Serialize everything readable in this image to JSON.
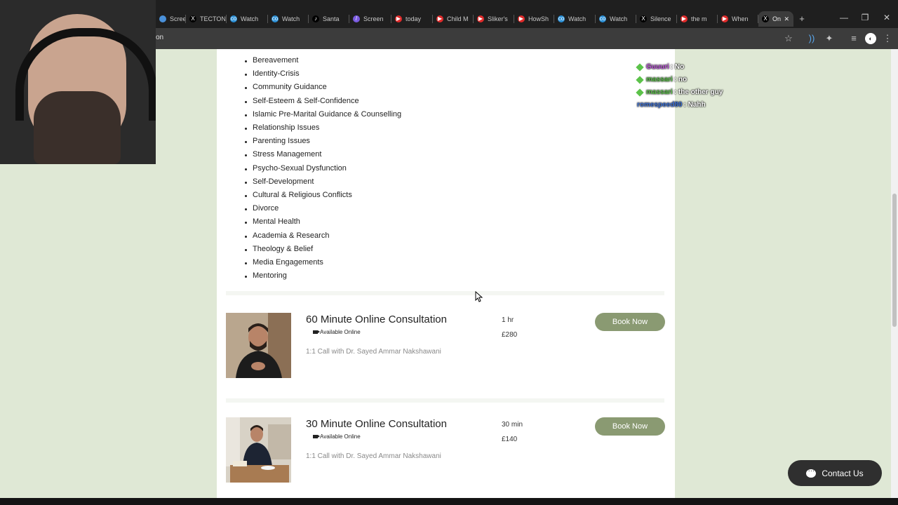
{
  "browser": {
    "tabs": [
      {
        "label": "Screen",
        "color": "#4a90d9",
        "glyph": ""
      },
      {
        "label": "TECTON",
        "color": "#000000",
        "glyph": "X"
      },
      {
        "label": "Watch",
        "color": "#2a8fd6",
        "glyph": "co"
      },
      {
        "label": "Watch",
        "color": "#2a8fd6",
        "glyph": "co"
      },
      {
        "label": "Santa",
        "color": "#000000",
        "glyph": "♪"
      },
      {
        "label": "Screen",
        "color": "#7a5be0",
        "glyph": "/"
      },
      {
        "label": "today",
        "color": "#e02b2b",
        "glyph": "▶"
      },
      {
        "label": "Child M",
        "color": "#e02b2b",
        "glyph": "▶"
      },
      {
        "label": "Sliker's",
        "color": "#e02b2b",
        "glyph": "▶"
      },
      {
        "label": "HowSh",
        "color": "#e02b2b",
        "glyph": "▶"
      },
      {
        "label": "Watch",
        "color": "#2a8fd6",
        "glyph": "co"
      },
      {
        "label": "Watch",
        "color": "#2a8fd6",
        "glyph": "co"
      },
      {
        "label": "Silence",
        "color": "#000000",
        "glyph": "X"
      },
      {
        "label": "the m",
        "color": "#e02b2b",
        "glyph": "▶"
      },
      {
        "label": "When",
        "color": "#e02b2b",
        "glyph": "▶"
      },
      {
        "label": "On",
        "color": "#000000",
        "glyph": "X"
      }
    ],
    "url": "on"
  },
  "services_list": [
    "Bereavement",
    "Identity-Crisis",
    "Community Guidance",
    "Self-Esteem & Self-Confidence",
    "Islamic Pre-Marital Guidance & Counselling",
    "Relationship Issues",
    "Parenting Issues",
    "Stress Management",
    "Psycho-Sexual Dysfunction",
    "Self-Development",
    "Cultural & Religious Conflicts",
    "Divorce",
    "Mental Health",
    "Academia & Research",
    "Theology & Belief",
    "Media Engagements",
    "Mentoring"
  ],
  "services": [
    {
      "name": "60 Minute Online Consultation",
      "availability": "Available Online",
      "description": "1:1 Call with Dr. Sayed Ammar Nakshawani",
      "duration": "1 hr",
      "price": "£280",
      "button": "Book Now"
    },
    {
      "name": "30 Minute Online Consultation",
      "availability": "Available Online",
      "description": "1:1 Call with Dr. Sayed Ammar Nakshawani",
      "duration": "30 min",
      "price": "£140",
      "button": "Book Now"
    }
  ],
  "chat": [
    {
      "user": "Guuuri",
      "message": ": No",
      "color": "#b84fd6"
    },
    {
      "user": "massari",
      "message": ": no",
      "color": "#5cc24a"
    },
    {
      "user": "massari",
      "message": ": the other guy",
      "color": "#5cc24a"
    },
    {
      "user": "romespeed80",
      "message": ": Nahh",
      "color": "#3a6fd6"
    }
  ],
  "contact": {
    "label": "Contact Us"
  },
  "colors": {
    "page_bg": "#dfe8d5",
    "button": "#8a9a72"
  }
}
